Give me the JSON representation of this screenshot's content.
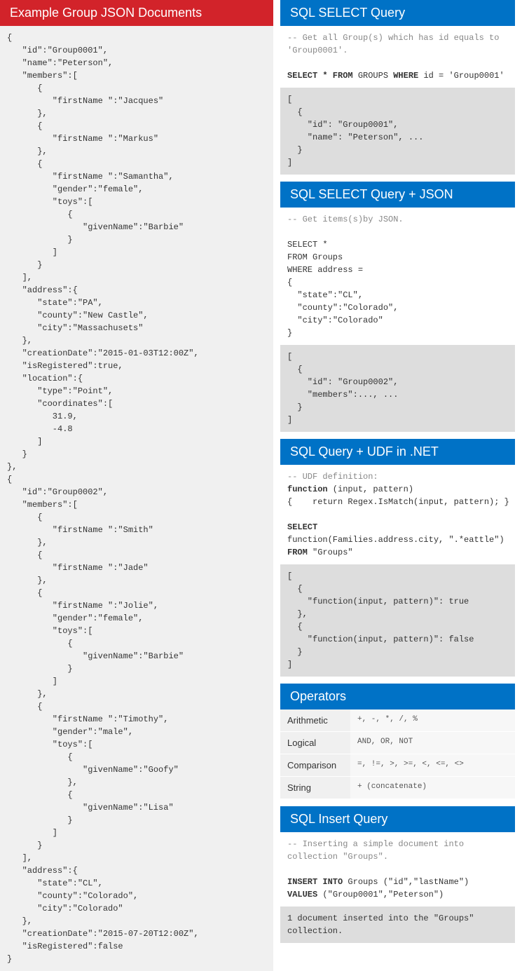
{
  "left": {
    "header": "Example Group JSON Documents",
    "json": "{\n   \"id\":\"Group0001\",\n   \"name\":\"Peterson\",\n   \"members\":[\n      {\n         \"firstName \":\"Jacques\"\n      },\n      {\n         \"firstName \":\"Markus\"\n      },\n      {\n         \"firstName \":\"Samantha\",\n         \"gender\":\"female\",\n         \"toys\":[\n            {\n               \"givenName\":\"Barbie\"\n            }\n         ]\n      }\n   ],\n   \"address\":{\n      \"state\":\"PA\",\n      \"county\":\"New Castle\",\n      \"city\":\"Massachusets\"\n   },\n   \"creationDate\":\"2015-01-03T12:00Z\",\n   \"isRegistered\":true,\n   \"location\":{\n      \"type\":\"Point\",\n      \"coordinates\":[\n         31.9,\n         -4.8\n      ]\n   }\n},\n{\n   \"id\":\"Group0002\",\n   \"members\":[\n      {\n         \"firstName \":\"Smith\"\n      },\n      {\n         \"firstName \":\"Jade\"\n      },\n      {\n         \"firstName \":\"Jolie\",\n         \"gender\":\"female\",\n         \"toys\":[\n            {\n               \"givenName\":\"Barbie\"\n            }\n         ]\n      },\n      {\n         \"firstName \":\"Timothy\",\n         \"gender\":\"male\",\n         \"toys\":[\n            {\n               \"givenName\":\"Goofy\"\n            },\n            {\n               \"givenName\":\"Lisa\"\n            }\n         ]\n      }\n   ],\n   \"address\":{\n      \"state\":\"CL\",\n      \"county\":\"Colorado\",\n      \"city\":\"Colorado\"\n   },\n   \"creationDate\":\"2015-07-20T12:00Z\",\n   \"isRegistered\":false\n}"
  },
  "select": {
    "header": "SQL SELECT Query",
    "comment": "-- Get all Group(s) which has id equals to 'Group0001'.",
    "query_html": "<span class=\"kw\">SELECT * FROM</span> GROUPS <span class=\"kw\">WHERE</span> id = 'Group0001'",
    "result": "[\n  {\n    \"id\": \"Group0001\",\n    \"name\": \"Peterson\", ...\n  }\n]"
  },
  "selectjson": {
    "header": "SQL SELECT Query + JSON",
    "comment": "-- Get items(s)by JSON.",
    "query": "SELECT *\nFROM Groups\nWHERE address =\n{\n  \"state\":\"CL\",\n  \"county\":\"Colorado\",\n  \"city\":\"Colorado\"\n}",
    "result": "[\n  {\n    \"id\": \"Group0002\",\n    \"members\":..., ...\n  }\n]"
  },
  "udf": {
    "header": "SQL Query + UDF in .NET",
    "block": "<span class=\"comment\">-- UDF definition:</span>\n<span class=\"kw\">function</span> (input, pattern)\n{    return Regex.IsMatch(input, pattern); }\n\n<span class=\"kw\">SELECT</span>\nfunction(Families.address.city, \".*eattle\")\n<span class=\"kw\">FROM</span> \"Groups\"",
    "result": "[\n  {\n    \"function(input, pattern)\": true\n  },\n  {\n    \"function(input, pattern)\": false\n  }\n]"
  },
  "operators": {
    "header": "Operators",
    "rows": [
      {
        "label": "Arithmetic",
        "val": "+, -, *, /, %"
      },
      {
        "label": "Logical",
        "val": "AND, OR, NOT"
      },
      {
        "label": "Comparison",
        "val": "=, !=, >, >=, <, <=, <>"
      },
      {
        "label": "String",
        "val": "+ (concatenate)"
      }
    ]
  },
  "insert": {
    "header": "SQL Insert Query",
    "comment": "-- Inserting a simple document into collection \"Groups\".",
    "query_html": "<span class=\"kw\">INSERT INTO</span> Groups (\"id\",\"lastName\")\n<span class=\"kw\">VALUES</span> (\"Group0001\",\"Peterson\")",
    "result": "1 document inserted into the \"Groups\"\ncollection."
  }
}
